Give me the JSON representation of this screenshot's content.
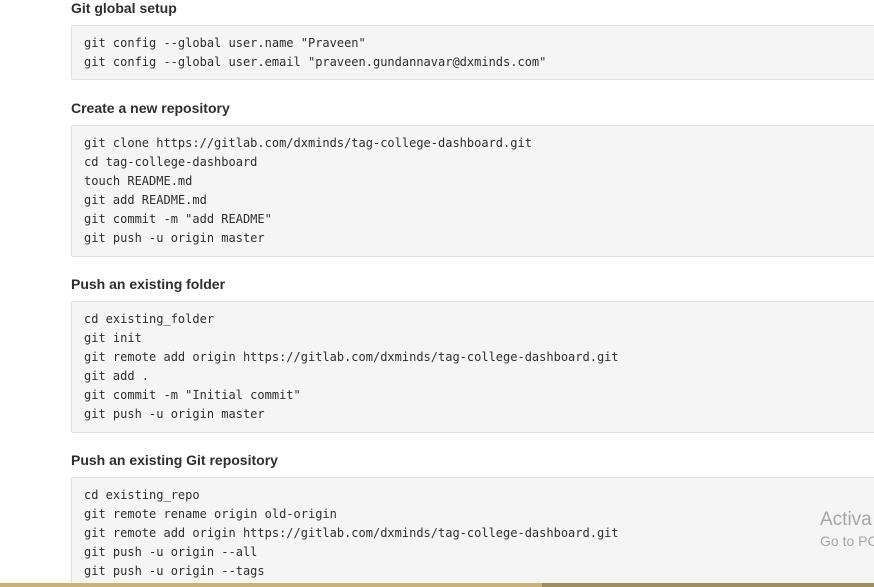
{
  "sections": [
    {
      "title": "Git global setup",
      "lines": [
        "git config --global user.name \"Praveen\"",
        "git config --global user.email \"praveen.gundannavar@dxminds.com\""
      ]
    },
    {
      "title": "Create a new repository",
      "lines": [
        "git clone https://gitlab.com/dxminds/tag-college-dashboard.git",
        "cd tag-college-dashboard",
        "touch README.md",
        "git add README.md",
        "git commit -m \"add README\"",
        "git push -u origin master"
      ]
    },
    {
      "title": "Push an existing folder",
      "lines": [
        "cd existing_folder",
        "git init",
        "git remote add origin https://gitlab.com/dxminds/tag-college-dashboard.git",
        "git add .",
        "git commit -m \"Initial commit\"",
        "git push -u origin master"
      ]
    },
    {
      "title": "Push an existing Git repository",
      "lines": [
        "cd existing_repo",
        "git remote rename origin old-origin",
        "git remote add origin https://gitlab.com/dxminds/tag-college-dashboard.git",
        "git push -u origin --all",
        "git push -u origin --tags"
      ]
    }
  ],
  "watermark": {
    "title": "Activa",
    "subtitle": "Go to PC"
  }
}
